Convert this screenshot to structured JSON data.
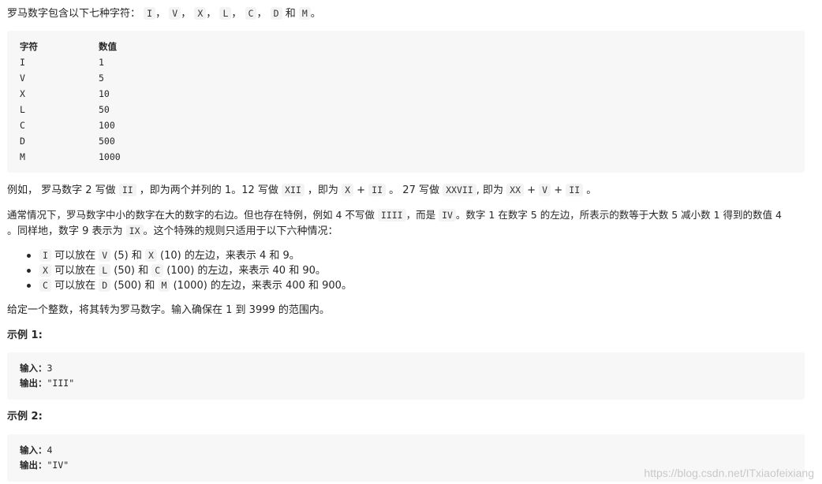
{
  "intro": {
    "text": "罗马数字包含以下七种字符：",
    "chars": [
      "I",
      "V",
      "X",
      "L",
      "C",
      "D",
      "M"
    ],
    "sep": "，",
    "and": "和",
    "end": "。"
  },
  "table": {
    "headers": [
      "字符",
      "数值"
    ],
    "rows": [
      [
        "I",
        "1"
      ],
      [
        "V",
        "5"
      ],
      [
        "X",
        "10"
      ],
      [
        "L",
        "50"
      ],
      [
        "C",
        "100"
      ],
      [
        "D",
        "500"
      ],
      [
        "M",
        "1000"
      ]
    ]
  },
  "example_line": {
    "t1": "例如， 罗马数字 2 写做 ",
    "c1": "II",
    "t2": " ，即为两个并列的 1。12 写做 ",
    "c2": "XII",
    "t3": " ，即为 ",
    "c3": "X",
    "t4": " + ",
    "c4": "II",
    "t5": " 。 27 写做  ",
    "c5": "XXVII",
    "t6": ", 即为 ",
    "c6": "XX",
    "t7": " + ",
    "c7": "V",
    "t8": " + ",
    "c8": "II",
    "t9": " 。"
  },
  "para2": {
    "line1_a": "通常情况下，罗马数字中小的数字在大的数字的右边。但也存在特例，例如 4 不写做 ",
    "line1_c1": "IIII",
    "line1_b": "，而是 ",
    "line1_c2": "IV",
    "line1_d": "。数字 1 在数字 5 的左边，所表示的数等于大数 5 减小数 1 得到的数值 4",
    "line2_a": "。同样地，数字 9 表示为 ",
    "line2_c": "IX",
    "line2_b": "。这个特殊的规则只适用于以下六种情况："
  },
  "rules": [
    {
      "c1": "I",
      "t1": " 可以放在 ",
      "c2": "V",
      "t2": " (5) 和 ",
      "c3": "X",
      "t3": " (10) 的左边，来表示 4 和 9。"
    },
    {
      "c1": "X",
      "t1": " 可以放在 ",
      "c2": "L",
      "t2": " (50) 和 ",
      "c3": "C",
      "t3": " (100) 的左边，来表示 40 和 90。"
    },
    {
      "c1": "C",
      "t1": " 可以放在 ",
      "c2": "D",
      "t2": " (500) 和 ",
      "c3": "M",
      "t3": " (1000) 的左边，来表示 400 和 900。"
    }
  ],
  "task": "给定一个整数，将其转为罗马数字。输入确保在 1 到 3999 的范围内。",
  "examples": [
    {
      "title": "示例 1:",
      "input_label": "输入：",
      "input": "3",
      "output_label": "输出：",
      "output": "\"III\""
    },
    {
      "title": "示例 2:",
      "input_label": "输入：",
      "input": "4",
      "output_label": "输出：",
      "output": "\"IV\""
    }
  ],
  "watermark": "https://blog.csdn.net/ITxiaofeixiang"
}
